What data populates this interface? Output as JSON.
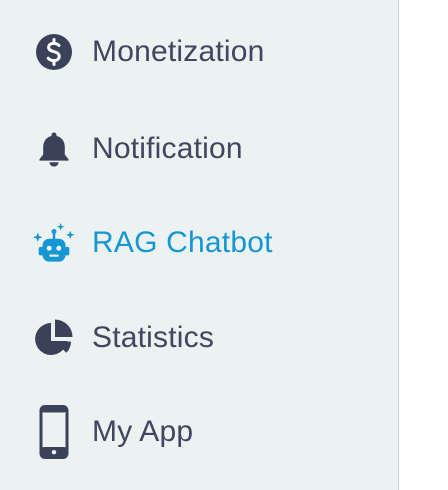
{
  "sidebar": {
    "colors": {
      "background": "#ecf1f1",
      "text": "#3e4660",
      "icon": "#394259",
      "active": "#1497d2",
      "divider": "#c9d3da"
    },
    "items": [
      {
        "label": "Monetization",
        "icon": "dollar-circle-icon",
        "active": false
      },
      {
        "label": "Notification",
        "icon": "bell-icon",
        "active": false
      },
      {
        "label": "RAG Chatbot",
        "icon": "robot-sparkle-icon",
        "active": true
      },
      {
        "label": "Statistics",
        "icon": "pie-chart-icon",
        "active": false
      },
      {
        "label": "My App",
        "icon": "smartphone-icon",
        "active": false
      }
    ]
  }
}
